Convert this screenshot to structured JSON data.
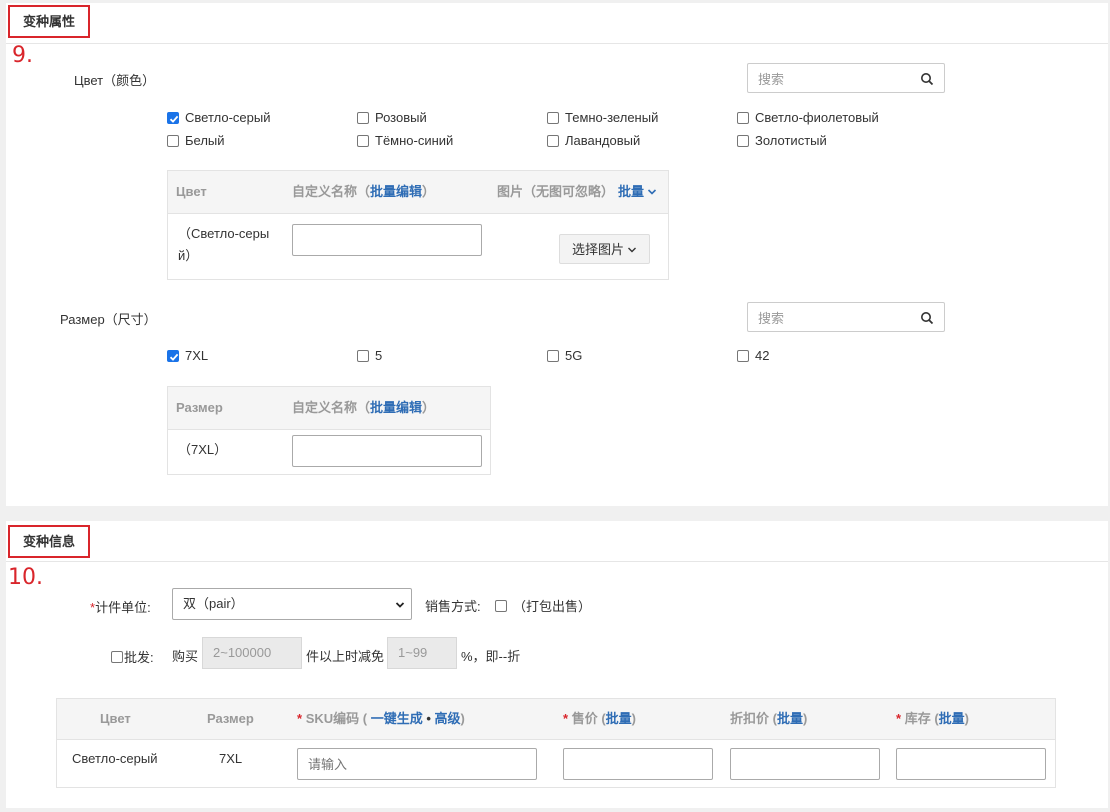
{
  "attr_section": {
    "title": "变种属性",
    "step": "9.",
    "color": {
      "label": "Цвет（颜色）",
      "search_placeholder": "搜索",
      "options": [
        {
          "label": "Светло-серый",
          "checked": true
        },
        {
          "label": "Розовый",
          "checked": false
        },
        {
          "label": "Темно-зеленый",
          "checked": false
        },
        {
          "label": "Светло-фиолетовый",
          "checked": false
        },
        {
          "label": "Белый",
          "checked": false
        },
        {
          "label": "Тёмно-синий",
          "checked": false
        },
        {
          "label": "Лавандовый",
          "checked": false
        },
        {
          "label": "Золотистый",
          "checked": false
        }
      ],
      "table": {
        "col1": "Цвет",
        "col2": "自定义名称",
        "col2_link": "批量编辑",
        "col3": "图片（无图可忽略）",
        "col3_link": "批量",
        "row_label_line1": "（Светло-серы",
        "row_label_line2": "й）",
        "custom_name_value": "",
        "select_image_button": "选择图片"
      }
    },
    "size": {
      "label": "Размер（尺寸）",
      "search_placeholder": "搜索",
      "options": [
        {
          "label": "7XL",
          "checked": true
        },
        {
          "label": "5",
          "checked": false
        },
        {
          "label": "5G",
          "checked": false
        },
        {
          "label": "42",
          "checked": false
        }
      ],
      "table": {
        "col1": "Размер",
        "col2": "自定义名称",
        "col2_link": "批量编辑",
        "row_label": "（7XL）",
        "custom_name_value": ""
      }
    }
  },
  "info_section": {
    "title": "变种信息",
    "step": "10.",
    "unit": {
      "label": "计件单位:",
      "value": "双（pair）"
    },
    "sale": {
      "label": "销售方式:",
      "option": "（打包出售）"
    },
    "wholesale": {
      "label": "批发:",
      "buy": "购买",
      "qty_placeholder": "2~100000",
      "middle": "件以上时减免",
      "pct_placeholder": "1~99",
      "suffix": "%，即--折"
    },
    "sku_table": {
      "headers": {
        "color": "Цвет",
        "size": "Размер",
        "sku": "SKU编码",
        "sku_gen": "一键生成",
        "sku_adv": "高级",
        "price": "售价",
        "discount": "折扣价",
        "stock": "库存",
        "batch": "批量"
      },
      "rows": [
        {
          "color": "Светло-серый",
          "size": "7XL",
          "sku_placeholder": "请输入"
        }
      ]
    }
  }
}
